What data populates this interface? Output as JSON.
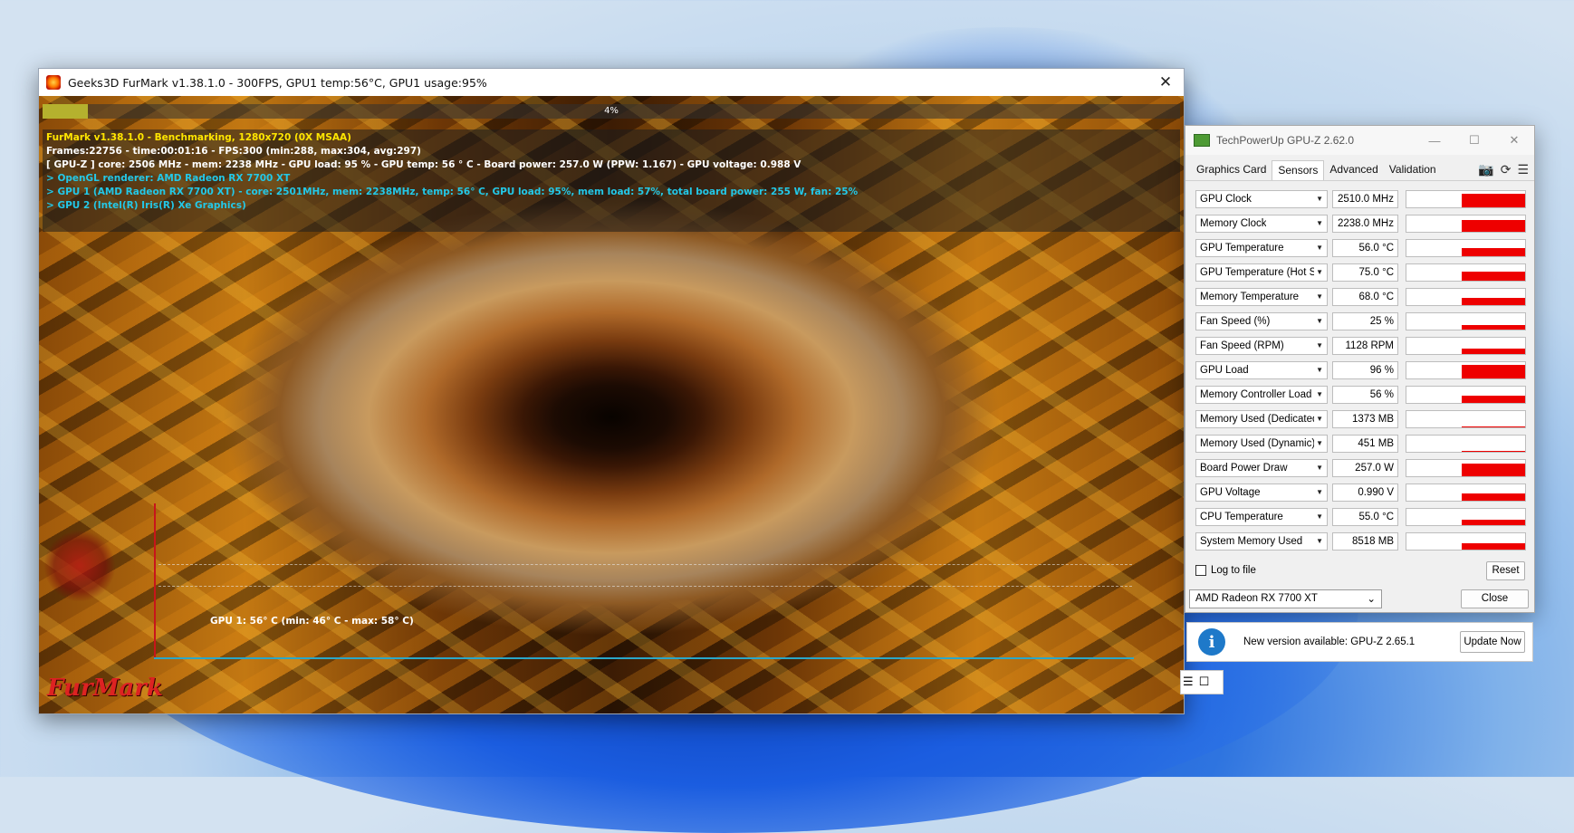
{
  "furmark": {
    "title": "Geeks3D FurMark v1.38.1.0 - 300FPS, GPU1 temp:56°C, GPU1 usage:95%",
    "close": "✕",
    "progress": {
      "percent": 4,
      "label": "4%"
    },
    "info": {
      "line1": "FurMark v1.38.1.0 - Benchmarking, 1280x720 (0X MSAA)",
      "line2": "Frames:22756 - time:00:01:16 - FPS:300 (min:288, max:304, avg:297)",
      "line3": "[ GPU-Z ] core: 2506 MHz - mem: 2238 MHz - GPU load: 95 % - GPU temp: 56 ° C - Board power: 257.0 W (PPW: 1.167) - GPU voltage: 0.988 V",
      "line4": "> OpenGL renderer: AMD Radeon RX 7700 XT",
      "line5": "> GPU 1 (AMD Radeon RX 7700 XT) - core: 2501MHz, mem: 2238MHz, temp: 56° C, GPU load: 95%, mem load: 57%, total board power: 255 W, fan: 25%",
      "line6": "> GPU 2 (Intel(R) Iris(R) Xe Graphics)"
    },
    "graph_label": "GPU 1: 56° C (min: 46° C - max: 58° C)",
    "logo": "FurMark"
  },
  "gpuz": {
    "title": "TechPowerUp GPU-Z 2.62.0",
    "window_buttons": {
      "minimize": "—",
      "maximize": "☐",
      "close": "✕"
    },
    "tabs": [
      {
        "label": "Graphics Card",
        "active": false
      },
      {
        "label": "Sensors",
        "active": true
      },
      {
        "label": "Advanced",
        "active": false
      },
      {
        "label": "Validation",
        "active": false
      }
    ],
    "toolbar": {
      "camera": "📷",
      "refresh": "⟳",
      "menu": "☰"
    },
    "sensors": [
      {
        "label": "GPU Clock",
        "value": "2510.0 MHz",
        "level": 0.95
      },
      {
        "label": "Memory Clock",
        "value": "2238.0 MHz",
        "level": 0.8
      },
      {
        "label": "GPU Temperature",
        "value": "56.0 °C",
        "level": 0.55
      },
      {
        "label": "GPU Temperature (Hot Spot)",
        "value": "75.0 °C",
        "level": 0.6
      },
      {
        "label": "Memory Temperature",
        "value": "68.0 °C",
        "level": 0.5
      },
      {
        "label": "Fan Speed (%)",
        "value": "25 %",
        "level": 0.3
      },
      {
        "label": "Fan Speed (RPM)",
        "value": "1128 RPM",
        "level": 0.35
      },
      {
        "label": "GPU Load",
        "value": "96 %",
        "level": 0.96
      },
      {
        "label": "Memory Controller Load",
        "value": "56 %",
        "level": 0.5
      },
      {
        "label": "Memory Used (Dedicated)",
        "value": "1373 MB",
        "level": 0.08
      },
      {
        "label": "Memory Used (Dynamic)",
        "value": "451 MB",
        "level": 0.05
      },
      {
        "label": "Board Power Draw",
        "value": "257.0 W",
        "level": 0.85
      },
      {
        "label": "GPU Voltage",
        "value": "0.990 V",
        "level": 0.5
      },
      {
        "label": "CPU Temperature",
        "value": "55.0 °C",
        "level": 0.4
      },
      {
        "label": "System Memory Used",
        "value": "8518 MB",
        "level": 0.45
      }
    ],
    "log_to_file": "Log to file",
    "reset": "Reset",
    "device": "AMD Radeon RX 7700 XT",
    "close": "Close",
    "update": {
      "text": "New version available: GPU-Z 2.65.1",
      "button": "Update Now",
      "icon": "i"
    }
  },
  "colors": {
    "graph_red": "#ee0000",
    "furmark_yellow": "#ffe600",
    "furmark_cyan": "#23c8e8"
  }
}
